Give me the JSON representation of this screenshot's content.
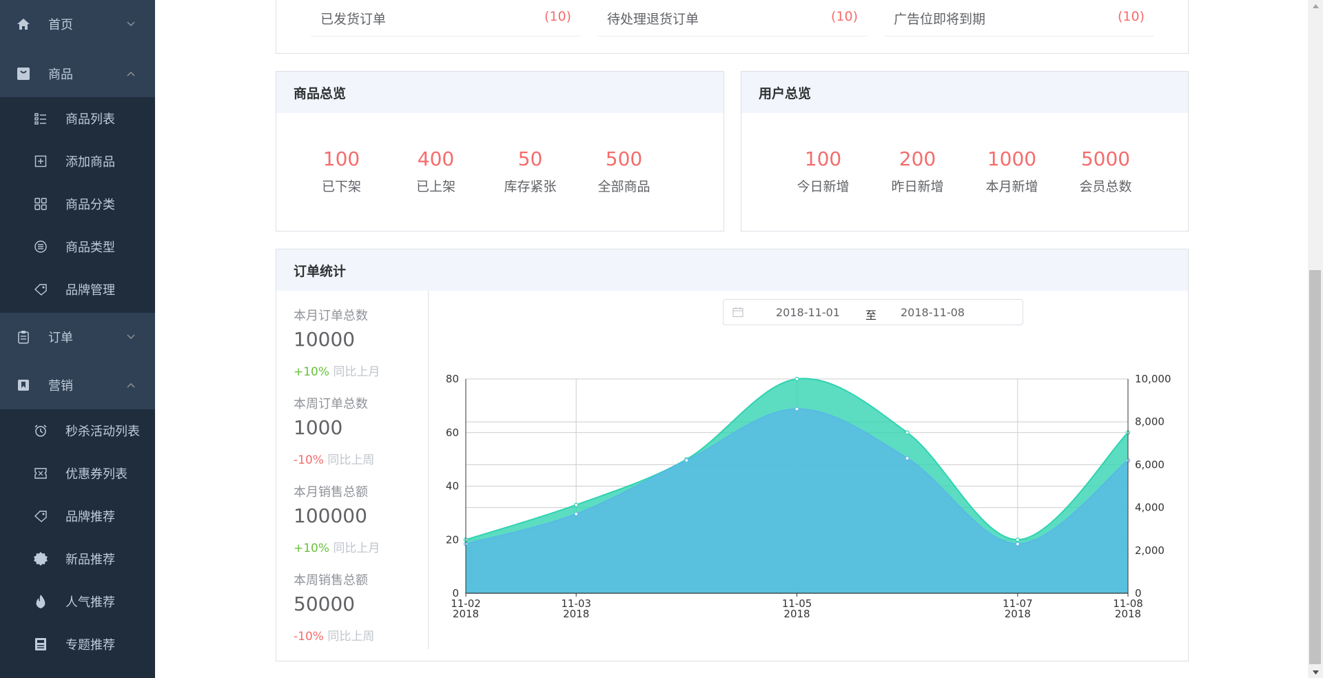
{
  "sidebar": {
    "top_items": [
      {
        "label": "首页",
        "icon": "home-icon"
      },
      {
        "label": "商品",
        "icon": "bag-icon"
      },
      {
        "label": "订单",
        "icon": "clipboard-icon"
      },
      {
        "label": "营销",
        "icon": "bookmark-icon"
      }
    ],
    "product_sub": [
      {
        "label": "商品列表",
        "icon": "list-icon"
      },
      {
        "label": "添加商品",
        "icon": "add-box-icon"
      },
      {
        "label": "商品分类",
        "icon": "grid-icon"
      },
      {
        "label": "商品类型",
        "icon": "circle-list-icon"
      },
      {
        "label": "品牌管理",
        "icon": "tag-icon"
      }
    ],
    "marketing_sub": [
      {
        "label": "秒杀活动列表",
        "icon": "alarm-clock-icon"
      },
      {
        "label": "优惠券列表",
        "icon": "coupon-icon"
      },
      {
        "label": "品牌推荐",
        "icon": "tag-icon"
      },
      {
        "label": "新品推荐",
        "icon": "new-badge-icon"
      },
      {
        "label": "人气推荐",
        "icon": "hot-flame-icon"
      },
      {
        "label": "专题推荐",
        "icon": "calculator-icon"
      }
    ]
  },
  "todo": [
    {
      "label": "已发货订单",
      "count": "(10)"
    },
    {
      "label": "待处理退货订单",
      "count": "(10)"
    },
    {
      "label": "广告位即将到期",
      "count": "(10)"
    }
  ],
  "product_overview": {
    "title": "商品总览",
    "stats": [
      {
        "value": "100",
        "label": "已下架"
      },
      {
        "value": "400",
        "label": "已上架"
      },
      {
        "value": "50",
        "label": "库存紧张"
      },
      {
        "value": "500",
        "label": "全部商品"
      }
    ]
  },
  "user_overview": {
    "title": "用户总览",
    "stats": [
      {
        "value": "100",
        "label": "今日新增"
      },
      {
        "value": "200",
        "label": "昨日新增"
      },
      {
        "value": "1000",
        "label": "本月新增"
      },
      {
        "value": "5000",
        "label": "会员总数"
      }
    ]
  },
  "order_stats": {
    "title": "订单统计",
    "items": [
      {
        "label": "本月订单总数",
        "value": "10000",
        "change": "+10%",
        "compare": "同比上月",
        "trend": "up"
      },
      {
        "label": "本周订单总数",
        "value": "1000",
        "change": "-10%",
        "compare": "同比上周",
        "trend": "down"
      },
      {
        "label": "本月销售总额",
        "value": "100000",
        "change": "+10%",
        "compare": "同比上月",
        "trend": "up"
      },
      {
        "label": "本周销售总额",
        "value": "50000",
        "change": "-10%",
        "compare": "同比上周",
        "trend": "down"
      }
    ],
    "date_start": "2018-11-01",
    "date_sep": "至",
    "date_end": "2018-11-08"
  },
  "chart_data": {
    "type": "area",
    "x": [
      "2018-11-02",
      "2018-11-03",
      "2018-11-04",
      "2018-11-05",
      "2018-11-06",
      "2018-11-07",
      "2018-11-08"
    ],
    "x_tick_labels": [
      {
        "date": "2018-11-02",
        "line1": "11-02",
        "line2": "2018"
      },
      {
        "date": "2018-11-03",
        "line1": "11-03",
        "line2": "2018"
      },
      {
        "date": "2018-11-05",
        "line1": "11-05",
        "line2": "2018"
      },
      {
        "date": "2018-11-07",
        "line1": "11-07",
        "line2": "2018"
      },
      {
        "date": "2018-11-08",
        "line1": "11-08",
        "line2": "2018"
      }
    ],
    "series": [
      {
        "axis": "left",
        "color": "#2ed3b0",
        "values": [
          20,
          33,
          50,
          80,
          60,
          20,
          60
        ]
      },
      {
        "axis": "right",
        "color": "#59b9e6",
        "values": [
          2300,
          3700,
          6200,
          8600,
          6300,
          2300,
          6200
        ]
      }
    ],
    "y_left": {
      "min": 0,
      "max": 80,
      "ticks": [
        "0",
        "20",
        "40",
        "60",
        "80"
      ]
    },
    "y_right": {
      "min": 0,
      "max": 10000,
      "ticks": [
        "0",
        "2,000",
        "4,000",
        "6,000",
        "8,000",
        "10,000"
      ]
    },
    "grid": true
  }
}
